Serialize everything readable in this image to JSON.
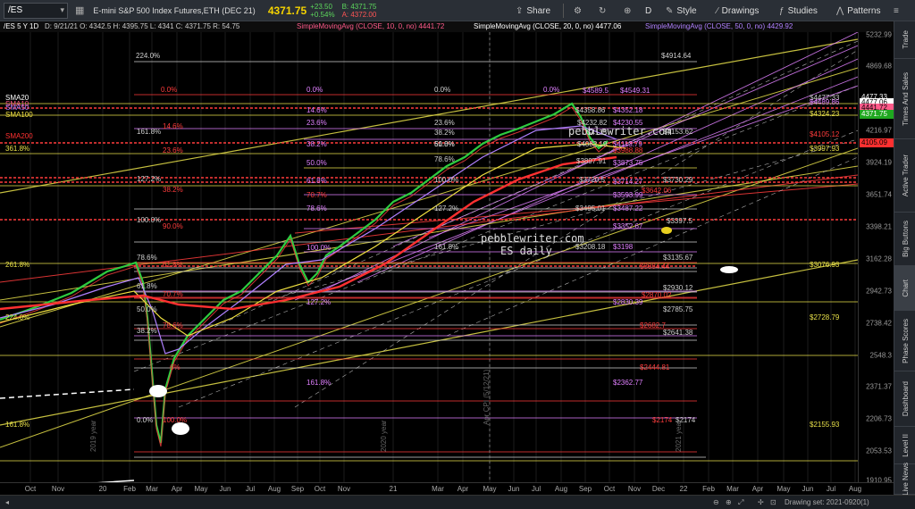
{
  "toolbar": {
    "symbol": "/ES",
    "symbol_name": "E-mini S&P 500 Index Futures,ETH (DEC 21)",
    "last": "4371.75",
    "change": "+23.50",
    "change_pct": "+0.54%",
    "bid": "B: 4371.75",
    "ask": "A: 4372.00",
    "share": "Share",
    "period": "D",
    "style": "Style",
    "drawings": "Drawings",
    "studies": "Studies",
    "patterns": "Patterns"
  },
  "info_bar": {
    "title": "/ES 5 Y 1D",
    "ohlc": "D: 9/21/21  O: 4342.5  H: 4395.75  L: 4341  C: 4371.75  R: 54.75",
    "sma10": "SimpleMovingAvg (CLOSE, 10, 0, no)  4441.72",
    "sma20": "SimpleMovingAvg (CLOSE, 20, 0, no)  4477.06",
    "sma50": "SimpleMovingAvg (CLOSE, 50, 0, no)  4429.92"
  },
  "colors": {
    "sma10": "#ff5a8a",
    "sma20": "#ffffff",
    "sma50": "#b080ff",
    "sma100": "#f0e040",
    "sma200": "#ff3030",
    "fib_yellow": "#e8e04a",
    "fib_magenta": "#e080ff",
    "fib_red": "#ff3c3c",
    "fib_white": "#cfcfcf"
  },
  "price_axis": [
    "5232.99",
    "4869.68",
    "4521.58",
    "4216.97",
    "3924.19",
    "3651.74",
    "3398.21",
    "3162.28",
    "2942.73",
    "2738.42",
    "2548.3",
    "2371.37",
    "2206.73",
    "2053.53",
    "1910.95"
  ],
  "price_boxes": [
    {
      "label": "4477.33",
      "bg": "#000000",
      "fg": "#ffffff"
    },
    {
      "label": "4477.06",
      "bg": "#ffffff",
      "fg": "#000000"
    },
    {
      "label": "4441.72",
      "bg": "#ff5a8a",
      "fg": "#000000"
    },
    {
      "label": "4371.75",
      "bg": "#1fa81f",
      "fg": "#ffffff"
    },
    {
      "label": "4105.09",
      "bg": "#ff3030",
      "fg": "#000000"
    }
  ],
  "time_axis": [
    "Oct",
    "Nov",
    "20",
    "Feb",
    "Mar",
    "Apr",
    "May",
    "Jun",
    "Jul",
    "Aug",
    "Sep",
    "Oct",
    "Nov",
    "21",
    "Mar",
    "Apr",
    "May",
    "Jun",
    "Jul",
    "Aug",
    "Sep",
    "Oct",
    "Nov",
    "Dec",
    "22",
    "Feb",
    "Mar",
    "Apr",
    "May",
    "Jun",
    "Jul",
    "Aug"
  ],
  "vertical_labels": [
    "2019 year",
    "2020 year",
    "Apr CPI (5/12/21)",
    "2021 year"
  ],
  "left_labels": [
    "SMA20",
    "SMA10",
    "SMA50",
    "SMA100",
    "SMA200"
  ],
  "fib_labels": [
    "224.0%",
    "0.0%",
    "0.0%",
    "0.0%",
    "0.0%",
    "14.6%",
    "14.6%",
    "23.6%",
    "23.6%",
    "38.2%",
    "161.8%",
    "50.0%",
    "38.2%",
    "61.8%",
    "361.8%",
    "23.6%",
    "50.0%",
    "78.6%",
    "127.2%",
    "61.8%",
    "100.0%",
    "38.2%",
    "70.7%",
    "78.6%",
    "127.2%",
    "100.0%",
    "90.0%",
    "100.0%",
    "161.8%",
    "78.6%",
    "261.8%",
    "61.8%",
    "61.8%",
    "50.0%",
    "127.2%",
    "224.0%",
    "78.6%",
    "38.2%",
    "70.7%",
    "161.8%",
    "0.0%",
    "100.0%",
    "161.8%",
    "6%"
  ],
  "price_levels": [
    "$4914.64",
    "$4477.33",
    "$4549.31",
    "$4489.86",
    "$4589.5",
    "$4358.86",
    "$4352.18",
    "$4324.23",
    "$4232.82",
    "$4230.55",
    "$4135",
    "$4153.62",
    "$4082.19",
    "$4113.79",
    "$4105.12",
    "$3997.93",
    "$3988.88",
    "$3897.91",
    "$3873.75",
    "$3720.5",
    "$3714.27",
    "$3730.29",
    "$3642.06",
    "$3593.99",
    "$3495.01",
    "$3487.22",
    "$3397.5",
    "$3352.67",
    "$3208.18",
    "$3198",
    "$3135.67",
    "$3084.44",
    "$3076.93",
    "$2930.12",
    "$2870.02",
    "$2830.39",
    "$2785.75",
    "$2728.79",
    "$2682.7",
    "$2641.38",
    "$2444.81",
    "$2362.77",
    "$2174",
    "$2174",
    "$2155.93"
  ],
  "watermark": {
    "site": "pebblewriter.com",
    "sub": "ES daily",
    "site2": "pebblewriter.com"
  },
  "sidebar_tabs": [
    "Trade",
    "Times And Sales",
    "Active Trader",
    "Big Buttons",
    "Chart",
    "Phase Scores",
    "Dashboard",
    "Level II",
    "Live News"
  ],
  "bottom": {
    "drawing_set": "Drawing set: 2021-0920(1)"
  }
}
